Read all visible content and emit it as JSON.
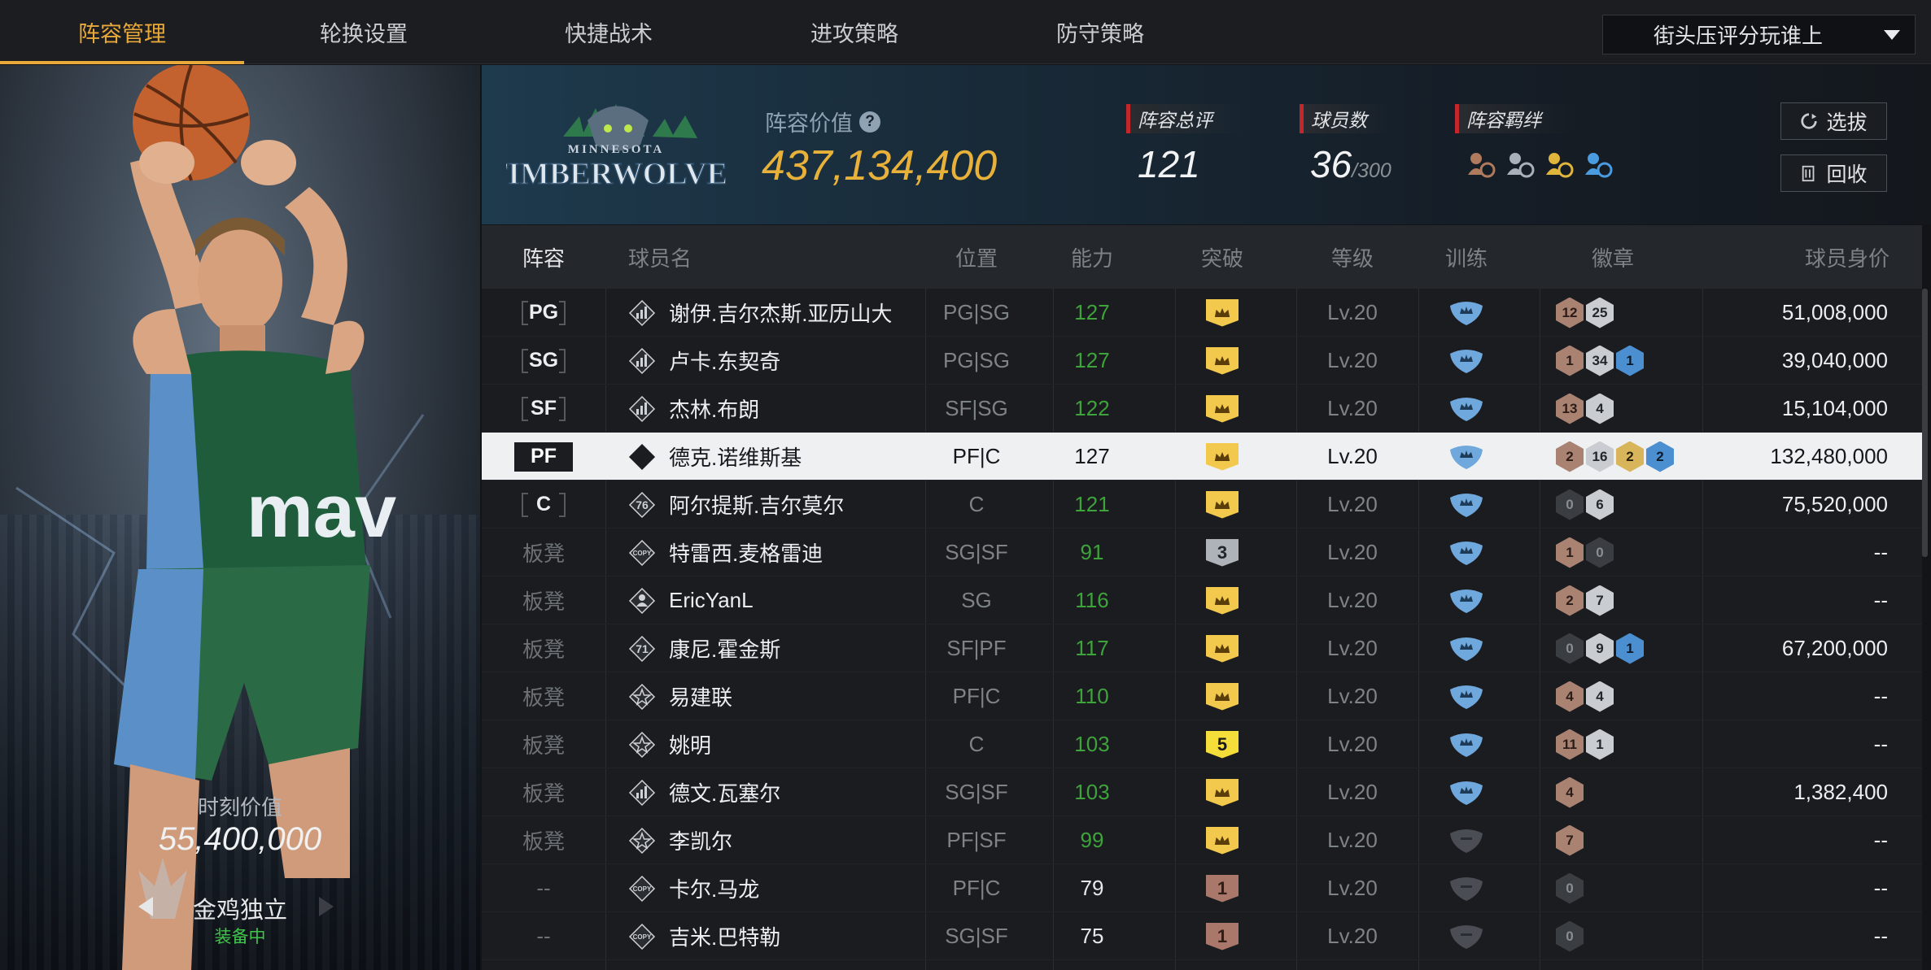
{
  "nav": {
    "tabs": [
      "阵容管理",
      "轮换设置",
      "快捷战术",
      "进攻策略",
      "防守策略"
    ],
    "active_tab": 0,
    "dropdown": "街头压评分玩谁上"
  },
  "player_card": {
    "jersey_text": "mav",
    "value_label": "时刻价值",
    "value": "55,400,000",
    "skill_name": "金鸡独立",
    "skill_status": "装备中"
  },
  "summary": {
    "team_logo_top": "MINNESOTA",
    "team_logo_main": "TIMBERWOLVES",
    "lineup_value_label": "阵容价值",
    "lineup_value": "437,134,400",
    "overall_label": "阵容总评",
    "overall_value": "121",
    "players_label": "球员数",
    "players_count": "36",
    "players_max": "/300",
    "bond_label": "阵容羁绊",
    "select_button": "选拔",
    "recycle_button": "回收"
  },
  "table": {
    "headers": [
      "阵容",
      "球员名",
      "位置",
      "能力",
      "突破",
      "等级",
      "训练",
      "徽章",
      "球员身价"
    ],
    "rows": [
      {
        "slot": "PG",
        "starter": true,
        "type": "bars",
        "type_text": "",
        "name": "谢伊.吉尔杰斯.亚历山大",
        "pos": "PG|SG",
        "ovr": "127",
        "break": "crown",
        "break_style": "gold",
        "lv": "Lv.20",
        "train": "on",
        "badges": [
          {
            "v": "12",
            "c": "bronze"
          },
          {
            "v": "25",
            "c": "silver"
          }
        ],
        "value": "51,008,000"
      },
      {
        "slot": "SG",
        "starter": true,
        "type": "bars",
        "type_text": "",
        "name": "卢卡.东契奇",
        "pos": "PG|SG",
        "ovr": "127",
        "break": "crown",
        "break_style": "gold",
        "lv": "Lv.20",
        "train": "on",
        "badges": [
          {
            "v": "1",
            "c": "bronze"
          },
          {
            "v": "34",
            "c": "silver"
          },
          {
            "v": "1",
            "c": "blue"
          }
        ],
        "value": "39,040,000"
      },
      {
        "slot": "SF",
        "starter": true,
        "type": "bars",
        "type_text": "",
        "name": "杰林.布朗",
        "pos": "SF|SG",
        "ovr": "122",
        "break": "crown",
        "break_style": "gold",
        "lv": "Lv.20",
        "train": "on",
        "badges": [
          {
            "v": "13",
            "c": "bronze"
          },
          {
            "v": "4",
            "c": "silver"
          }
        ],
        "value": "15,104,000"
      },
      {
        "slot": "PF",
        "starter": true,
        "highlight": true,
        "type": "era",
        "type_text": "06",
        "name": "德克.诺维斯基",
        "pos": "PF|C",
        "ovr": "127",
        "break": "crown",
        "break_style": "gold",
        "lv": "Lv.20",
        "train": "on",
        "badges": [
          {
            "v": "2",
            "c": "bronze"
          },
          {
            "v": "16",
            "c": "silver"
          },
          {
            "v": "2",
            "c": "gold"
          },
          {
            "v": "2",
            "c": "blue"
          }
        ],
        "value": "132,480,000"
      },
      {
        "slot": "C",
        "starter": true,
        "type": "era",
        "type_text": "76",
        "name": "阿尔提斯.吉尔莫尔",
        "pos": "C",
        "ovr": "121",
        "break": "crown",
        "break_style": "gold",
        "lv": "Lv.20",
        "train": "on",
        "badges": [
          {
            "v": "0",
            "c": "dark"
          },
          {
            "v": "6",
            "c": "silver"
          }
        ],
        "value": "75,520,000"
      },
      {
        "slot": "板凳",
        "starter": false,
        "type": "copy",
        "type_text": "COPY",
        "name": "特雷西.麦格雷迪",
        "pos": "SG|SF",
        "ovr": "91",
        "break": "3",
        "break_style": "grey",
        "lv": "Lv.20",
        "train": "on",
        "badges": [
          {
            "v": "1",
            "c": "bronze"
          },
          {
            "v": "0",
            "c": "dark"
          }
        ],
        "value": "--"
      },
      {
        "slot": "板凳",
        "starter": false,
        "type": "person",
        "type_text": "",
        "name": "EricYanL",
        "pos": "SG",
        "ovr": "116",
        "break": "crown",
        "break_style": "gold",
        "lv": "Lv.20",
        "train": "on",
        "badges": [
          {
            "v": "2",
            "c": "bronze"
          },
          {
            "v": "7",
            "c": "silver"
          }
        ],
        "value": "--"
      },
      {
        "slot": "板凳",
        "starter": false,
        "type": "era",
        "type_text": "71",
        "name": "康尼.霍金斯",
        "pos": "SF|PF",
        "ovr": "117",
        "break": "crown",
        "break_style": "gold",
        "lv": "Lv.20",
        "train": "on",
        "badges": [
          {
            "v": "0",
            "c": "dark"
          },
          {
            "v": "9",
            "c": "silver"
          },
          {
            "v": "1",
            "c": "blue"
          }
        ],
        "value": "67,200,000"
      },
      {
        "slot": "板凳",
        "starter": false,
        "type": "star",
        "type_text": "",
        "name": "易建联",
        "pos": "PF|C",
        "ovr": "110",
        "break": "crown",
        "break_style": "gold",
        "lv": "Lv.20",
        "train": "on",
        "badges": [
          {
            "v": "4",
            "c": "bronze"
          },
          {
            "v": "4",
            "c": "silver"
          }
        ],
        "value": "--"
      },
      {
        "slot": "板凳",
        "starter": false,
        "type": "star",
        "type_text": "",
        "name": "姚明",
        "pos": "C",
        "ovr": "103",
        "break": "5",
        "break_style": "yellow",
        "lv": "Lv.20",
        "train": "on",
        "badges": [
          {
            "v": "11",
            "c": "bronze"
          },
          {
            "v": "1",
            "c": "silver"
          }
        ],
        "value": "--"
      },
      {
        "slot": "板凳",
        "starter": false,
        "type": "bars",
        "type_text": "",
        "name": "德文.瓦塞尔",
        "pos": "SG|SF",
        "ovr": "103",
        "break": "crown",
        "break_style": "gold",
        "lv": "Lv.20",
        "train": "on",
        "badges": [
          {
            "v": "4",
            "c": "bronze"
          }
        ],
        "value": "1,382,400"
      },
      {
        "slot": "板凳",
        "starter": false,
        "type": "star",
        "type_text": "",
        "name": "李凯尔",
        "pos": "PF|SF",
        "ovr": "99",
        "break": "crown",
        "break_style": "gold",
        "lv": "Lv.20",
        "train": "off",
        "badges": [
          {
            "v": "7",
            "c": "bronze"
          }
        ],
        "value": "--"
      },
      {
        "slot": "--",
        "starter": false,
        "type": "copy",
        "type_text": "COPY",
        "name": "卡尔.马龙",
        "pos": "PF|C",
        "ovr": "79",
        "ovr_white": true,
        "break": "1",
        "break_style": "bronze",
        "lv": "Lv.20",
        "train": "off",
        "badges": [
          {
            "v": "0",
            "c": "dark"
          }
        ],
        "value": "--"
      },
      {
        "slot": "--",
        "starter": false,
        "type": "copy",
        "type_text": "COPY",
        "name": "吉米.巴特勒",
        "pos": "SG|SF",
        "ovr": "75",
        "ovr_white": true,
        "break": "1",
        "break_style": "bronze",
        "lv": "Lv.20",
        "train": "off",
        "badges": [
          {
            "v": "0",
            "c": "dark"
          }
        ],
        "value": "--"
      }
    ]
  },
  "colors": {
    "accent": "#e8a93a",
    "ovr_green": "#3fa33b",
    "equipped_green": "#3fc64a",
    "stat_red": "#c3262b"
  }
}
